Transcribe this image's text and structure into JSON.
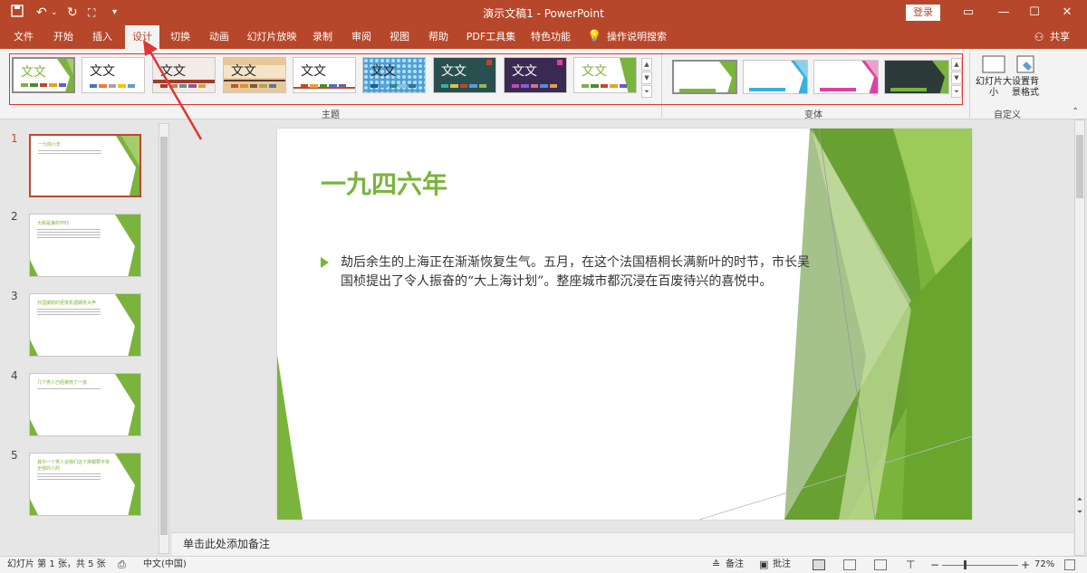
{
  "titlebar": {
    "doc_title": "演示文稿1 - PowerPoint",
    "login": "登录",
    "save_icon": "save-icon",
    "undo_icon": "undo-icon",
    "redo_icon": "redo-icon",
    "present_icon": "present-from-start-icon"
  },
  "menu": {
    "tabs": [
      "文件",
      "开始",
      "插入",
      "设计",
      "切换",
      "动画",
      "幻灯片放映",
      "录制",
      "审阅",
      "视图",
      "帮助",
      "PDF工具集",
      "特色功能",
      "操作说明搜索"
    ],
    "active": "设计",
    "share": "共享"
  },
  "ribbon": {
    "themes_label": "主题",
    "variants_label": "变体",
    "custom_label": "自定义",
    "themes": [
      {
        "text": "文文",
        "bg": "#ffffff",
        "fg": "#7ab43c"
      },
      {
        "text": "文文",
        "bg": "#ffffff",
        "fg": "#222222"
      },
      {
        "text": "文文",
        "bg": "#f2ebe6",
        "fg": "#222222"
      },
      {
        "text": "文文",
        "bg": "#e8c89a",
        "fg": "#222222"
      },
      {
        "text": "文文",
        "bg": "#ffffff",
        "fg": "#222222"
      },
      {
        "text": "文文",
        "bg": "#4aa0d8",
        "fg": "#222222"
      },
      {
        "text": "文文",
        "bg": "#2a4f4f",
        "fg": "#ffffff"
      },
      {
        "text": "文文",
        "bg": "#3a2a52",
        "fg": "#ffffff"
      },
      {
        "text": "文文",
        "bg": "#ffffff",
        "fg": "#7ab43c"
      }
    ],
    "slide_size": "幻灯片大小",
    "format_bg": "设置背景格式"
  },
  "slides": [
    {
      "num": "1",
      "title": "一九四六年"
    },
    {
      "num": "2",
      "title": "大街是谁的环时"
    },
    {
      "num": "3",
      "title": "外国援助的更变机遇期供大声"
    },
    {
      "num": "4",
      "title": "几个男人已经被死了一批"
    },
    {
      "num": "5",
      "title": "其中一个男人说我们这个排都要平常全部的人的"
    }
  ],
  "slide": {
    "title": "一九四六年",
    "body": "劫后余生的上海正在渐渐恢复生气。五月，在这个法国梧桐长满新叶的时节，市长吴国桢提出了令人振奋的“大上海计划”。整座城市都沉浸在百废待兴的喜悦中。"
  },
  "notes": "单击此处添加备注",
  "status": {
    "slide_info": "幻灯片 第 1 张，共 5 张",
    "language": "中文(中国)",
    "notes_btn": "备注",
    "comments_btn": "批注",
    "zoom": "72%"
  },
  "colors": {
    "brand": "#b7472a",
    "accent_green": "#7ab43c",
    "annotation_red": "#e03535"
  }
}
